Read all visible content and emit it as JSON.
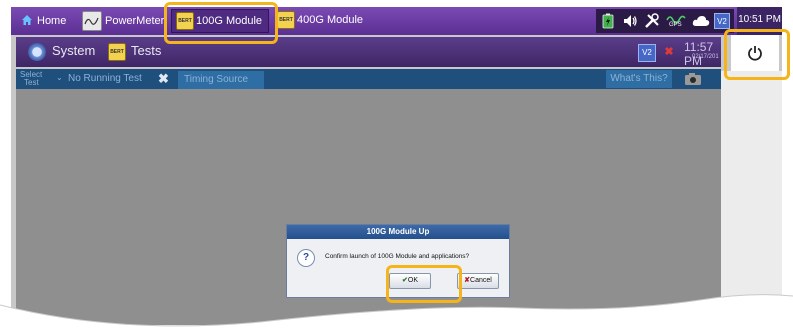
{
  "taskbar": {
    "home": "Home",
    "powermeter": "PowerMeter",
    "module_100g": "100G Module",
    "module_400g": "400G Module",
    "status_v2": "V2",
    "gps": "GPS",
    "clock": "10:51 PM",
    "bert_badge": "BERT"
  },
  "app": {
    "system_label": "System",
    "tests_label": "Tests",
    "v2": "V2",
    "time": "11:57 PM",
    "date": "02/17/201"
  },
  "tabs": {
    "select_test_line1": "Select",
    "select_test_line2": "Test",
    "no_running_test": "No Running Test",
    "close_glyph": "✖",
    "timing_source": "Timing Source",
    "whats_this": "What's This?"
  },
  "dialog": {
    "title": "100G Module Up",
    "message": "Confirm launch of 100G Module and applications?",
    "ok_label": "OK",
    "cancel_label": "Cancel"
  },
  "colors": {
    "highlight": "#f4b41a",
    "taskbar": "#6a3fa6",
    "tab_bar": "#1f4f7d"
  }
}
